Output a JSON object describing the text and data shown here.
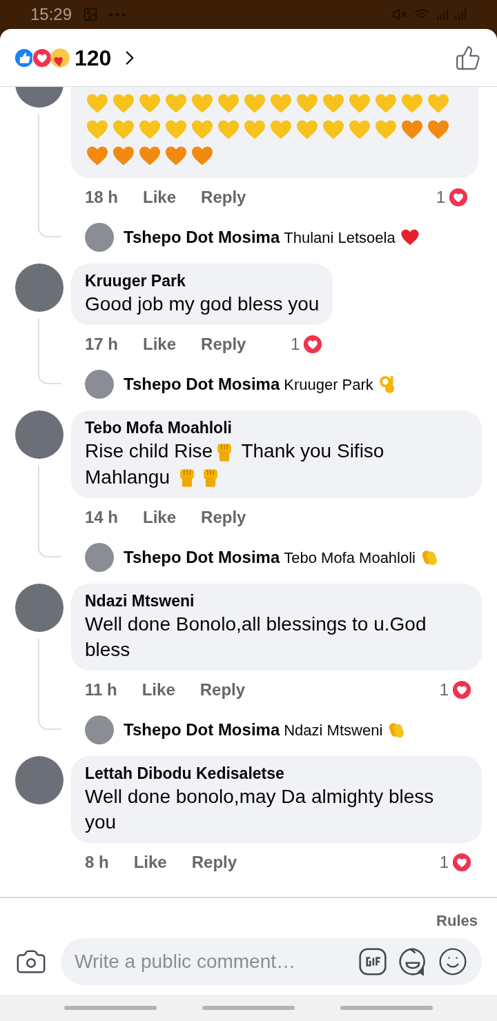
{
  "status_bar": {
    "time": "15:29"
  },
  "header": {
    "reaction_count": "120"
  },
  "comments": [
    {
      "time": "18 h",
      "like": "Like",
      "reply": "Reply",
      "reaction_count": "1",
      "body": [
        {
          "kind": "heart",
          "color": "#f7c21b"
        },
        {
          "kind": "heart",
          "color": "#f7c21b"
        },
        {
          "kind": "heart",
          "color": "#f7c21b"
        },
        {
          "kind": "heart",
          "color": "#f7c21b"
        },
        {
          "kind": "heart",
          "color": "#f7c21b"
        },
        {
          "kind": "heart",
          "color": "#f7c21b"
        },
        {
          "kind": "heart",
          "color": "#f7c21b"
        },
        {
          "kind": "heart",
          "color": "#f7c21b"
        },
        {
          "kind": "heart",
          "color": "#f7c21b"
        },
        {
          "kind": "heart",
          "color": "#f7c21b"
        },
        {
          "kind": "heart",
          "color": "#f7c21b"
        },
        {
          "kind": "heart",
          "color": "#f7c21b"
        },
        {
          "kind": "heart",
          "color": "#f7c21b"
        },
        {
          "kind": "heart",
          "color": "#f7c21b"
        },
        {
          "kind": "heart",
          "color": "#f7c21b"
        },
        {
          "kind": "heart",
          "color": "#f7c21b"
        },
        {
          "kind": "heart",
          "color": "#f7c21b"
        },
        {
          "kind": "heart",
          "color": "#f7c21b"
        },
        {
          "kind": "heart",
          "color": "#f7c21b"
        },
        {
          "kind": "heart",
          "color": "#f7c21b"
        },
        {
          "kind": "heart",
          "color": "#f7c21b"
        },
        {
          "kind": "heart",
          "color": "#f7c21b"
        },
        {
          "kind": "heart",
          "color": "#f7c21b"
        },
        {
          "kind": "heart",
          "color": "#f7c21b"
        },
        {
          "kind": "heart",
          "color": "#f7c21b"
        },
        {
          "kind": "heart",
          "color": "#f7c21b"
        },
        {
          "kind": "heart",
          "color": "#f28a10"
        },
        {
          "kind": "heart",
          "color": "#f28a10"
        },
        {
          "kind": "heart",
          "color": "#f28a10"
        },
        {
          "kind": "heart",
          "color": "#f28a10"
        },
        {
          "kind": "heart",
          "color": "#f28a10"
        },
        {
          "kind": "heart",
          "color": "#f28a10"
        },
        {
          "kind": "heart",
          "color": "#f28a10"
        }
      ],
      "reply_preview": {
        "name": "Tshepo Dot Mosima",
        "text": "Thulani Letsoela",
        "emoji": {
          "kind": "heart",
          "color": "#e8202e"
        }
      }
    },
    {
      "name": "Kruuger Park",
      "time": "17 h",
      "like": "Like",
      "reply": "Reply",
      "reaction_count": "1",
      "body": [
        {
          "kind": "text",
          "text": "Good job my god bless you"
        }
      ],
      "reply_preview": {
        "name": "Tshepo Dot Mosima",
        "text": "Kruuger Park",
        "emoji": {
          "kind": "ok"
        }
      }
    },
    {
      "name": "Tebo Mofa Moahloli",
      "time": "14 h",
      "like": "Like",
      "reply": "Reply",
      "body": [
        {
          "kind": "text",
          "text": "Rise child Rise"
        },
        {
          "kind": "fist"
        },
        {
          "kind": "text",
          "text": " Thank you Sifiso Mahlangu "
        },
        {
          "kind": "fist"
        },
        {
          "kind": "fist"
        }
      ],
      "reply_preview": {
        "name": "Tshepo Dot Mosima",
        "text": "Tebo Mofa Moahloli",
        "emoji": {
          "kind": "clap"
        }
      }
    },
    {
      "name": "Ndazi Mtsweni",
      "time": "11 h",
      "like": "Like",
      "reply": "Reply",
      "reaction_count": "1",
      "body": [
        {
          "kind": "text",
          "text": "Well done Bonolo,all blessings to u.God bless"
        }
      ],
      "reply_preview": {
        "name": "Tshepo Dot Mosima",
        "text": "Ndazi Mtsweni",
        "emoji": {
          "kind": "clap"
        }
      }
    },
    {
      "name": "Lettah Dibodu Kedisaletse",
      "time": "8 h",
      "like": "Like",
      "reply": "Reply",
      "reaction_count": "1",
      "body": [
        {
          "kind": "text",
          "text": "Well done bonolo,may Da almighty bless you"
        }
      ]
    }
  ],
  "footer": {
    "rules": "Rules",
    "placeholder": "Write a public comment…"
  }
}
